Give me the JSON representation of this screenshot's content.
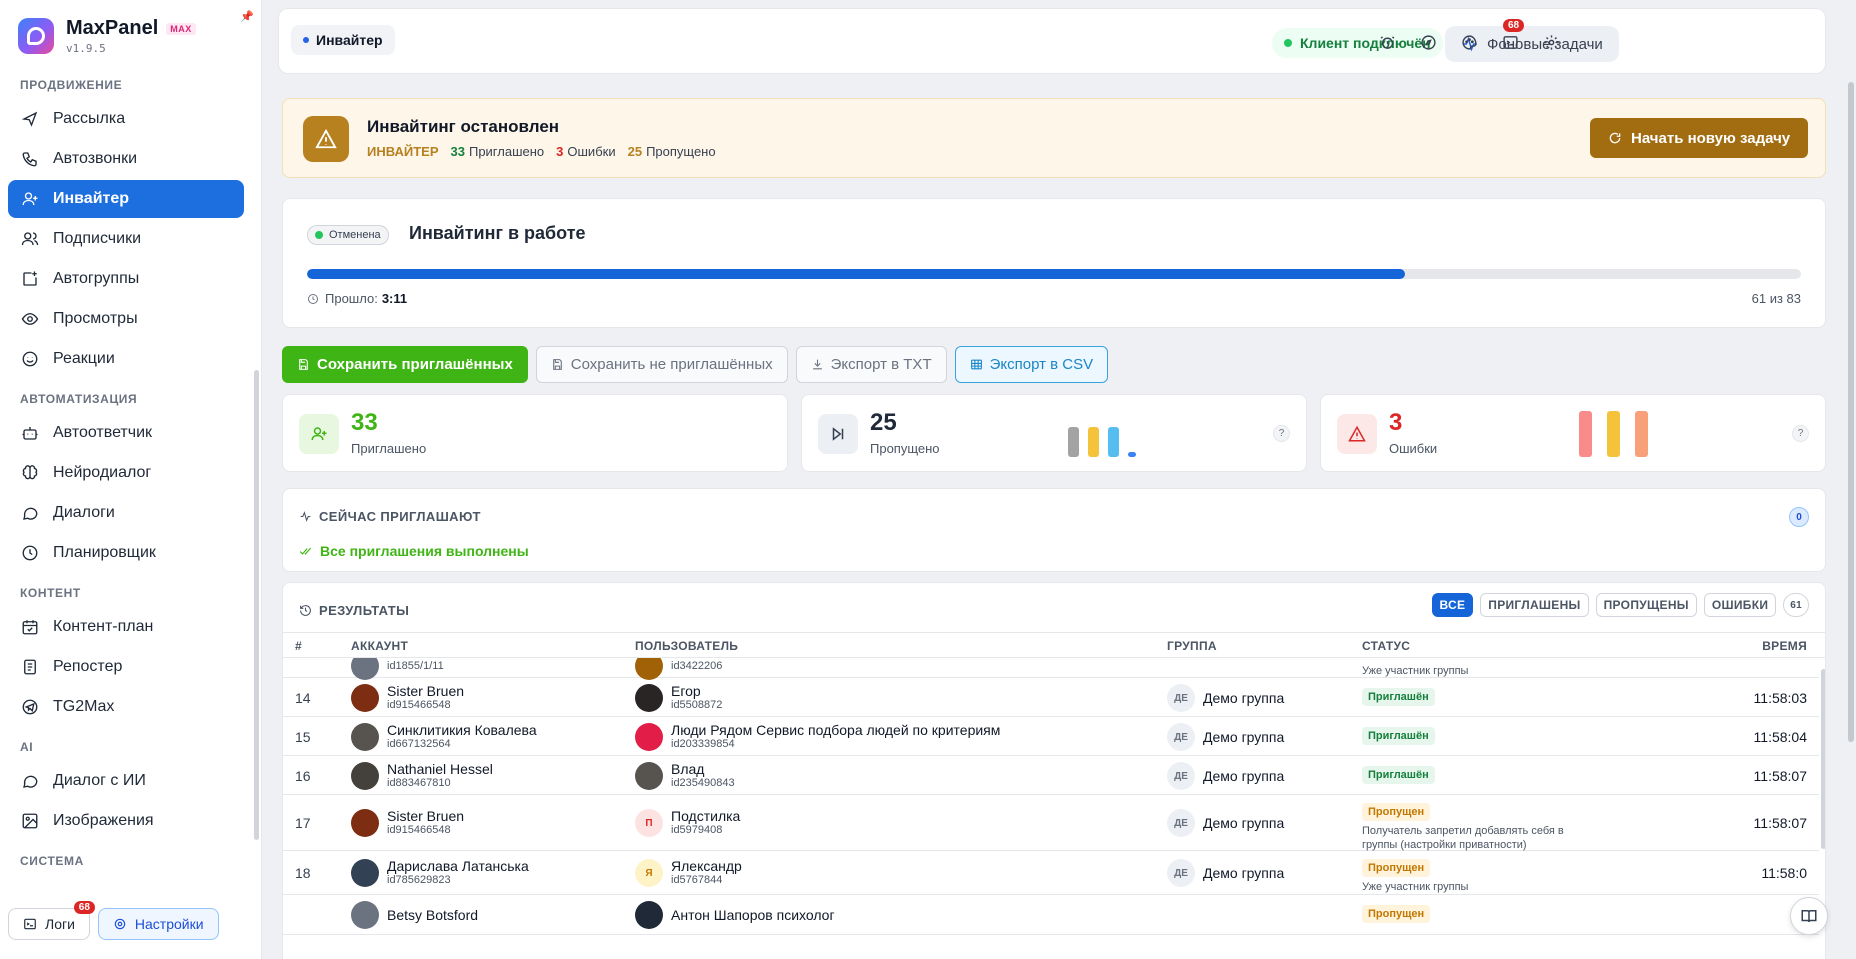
{
  "brand": {
    "name": "MaxPanel",
    "badge": "MAX",
    "version": "v1.9.5"
  },
  "sidebar": {
    "sections": [
      {
        "title": "ПРОДВИЖЕНИЕ",
        "items": [
          {
            "label": "Рассылка",
            "icon": "send-icon"
          },
          {
            "label": "Автозвонки",
            "icon": "phone-icon"
          },
          {
            "label": "Инвайтер",
            "icon": "user-plus-icon",
            "active": true
          },
          {
            "label": "Подписчики",
            "icon": "users-icon"
          },
          {
            "label": "Автогруппы",
            "icon": "square-plus-icon"
          },
          {
            "label": "Просмотры",
            "icon": "eye-icon"
          },
          {
            "label": "Реакции",
            "icon": "smile-icon"
          }
        ]
      },
      {
        "title": "АВТОМАТИЗАЦИЯ",
        "items": [
          {
            "label": "Автоответчик",
            "icon": "bot-icon"
          },
          {
            "label": "Нейродиалог",
            "icon": "brain-icon"
          },
          {
            "label": "Диалоги",
            "icon": "chat-icon"
          },
          {
            "label": "Планировщик",
            "icon": "clock-icon"
          }
        ]
      },
      {
        "title": "КОНТЕНТ",
        "items": [
          {
            "label": "Контент-план",
            "icon": "calendar-icon"
          },
          {
            "label": "Репостер",
            "icon": "repost-icon"
          },
          {
            "label": "TG2Max",
            "icon": "telegram-icon"
          }
        ]
      },
      {
        "title": "AI",
        "items": [
          {
            "label": "Диалог с ИИ",
            "icon": "chat-icon"
          },
          {
            "label": "Изображения",
            "icon": "image-icon"
          }
        ]
      },
      {
        "title": "СИСТЕМА",
        "items": []
      }
    ],
    "footer": {
      "logs_label": "Логи",
      "logs_badge": "68",
      "settings_label": "Настройки"
    }
  },
  "topbar": {
    "breadcrumb": "Инвайтер",
    "client_status": "Клиент подключён",
    "bg_tasks_label": "Фоновые задачи",
    "notifications_badge": "68",
    "icons": [
      "alarm-icon",
      "compass-icon",
      "palette-icon",
      "terminal-icon",
      "settings-icon"
    ]
  },
  "alert": {
    "title": "Инвайтинг остановлен",
    "tag": "ИНВАЙТЕР",
    "invited_num": "33",
    "invited_label": "Приглашено",
    "errors_num": "3",
    "errors_label": "Ошибки",
    "skipped_num": "25",
    "skipped_label": "Пропущено",
    "button_label": "Начать новую задачу"
  },
  "progress": {
    "state": "Отменена",
    "title": "Инвайтинг в работе",
    "elapsed_label": "Прошло:",
    "elapsed_value": "3:11",
    "done": 61,
    "total": 83,
    "count_text": "61 из 83"
  },
  "actions": {
    "save_invited": "Сохранить приглашённых",
    "save_not_invited": "Сохранить не приглашённых",
    "export_txt": "Экспорт в TXT",
    "export_csv": "Экспорт в CSV"
  },
  "stats": {
    "invited": {
      "value": "33",
      "label": "Приглашено",
      "color": "#3fb515"
    },
    "skipped": {
      "value": "25",
      "label": "Пропущено",
      "help": "?",
      "bars": [
        0.8,
        0.8,
        0.8,
        0.12
      ]
    },
    "errors": {
      "value": "3",
      "label": "Ошибки",
      "help": "?",
      "color": "#dc2626",
      "bars": [
        1,
        1,
        1
      ]
    }
  },
  "now_inviting": {
    "title": "СЕЙЧАС ПРИГЛАШАЮТ",
    "count": "0",
    "done_text": "Все приглашения выполнены"
  },
  "results": {
    "title": "РЕЗУЛЬТАТЫ",
    "filters": [
      "ВСЕ",
      "ПРИГЛАШЕНЫ",
      "ПРОПУЩЕНЫ",
      "ОШИБКИ"
    ],
    "total": "61",
    "columns": {
      "num": "#",
      "account": "АККАУНТ",
      "user": "ПОЛЬЗОВАТЕЛЬ",
      "group": "ГРУППА",
      "status": "СТАТУС",
      "time": "ВРЕМЯ"
    },
    "partial_top": {
      "account_id": "id1855/1/11",
      "user_id": "id3422206",
      "note": "Уже участник группы"
    },
    "rows": [
      {
        "num": "14",
        "acc_name": "Sister Bruen",
        "acc_id": "id915466548",
        "user_name": "Егор",
        "user_id": "id5508872",
        "group_initials": "ДЕ",
        "group": "Демо группа",
        "status": "Приглашён",
        "note": "",
        "time": "11:58:03"
      },
      {
        "num": "15",
        "acc_name": "Синклитикия Ковалева",
        "acc_id": "id667132564",
        "user_name": "Люди Рядом Сервис подбора людей по критериям",
        "user_id": "id203339854",
        "group_initials": "ДЕ",
        "group": "Демо группа",
        "status": "Приглашён",
        "note": "",
        "time": "11:58:04"
      },
      {
        "num": "16",
        "acc_name": "Nathaniel Hessel",
        "acc_id": "id883467810",
        "user_name": "Влад",
        "user_id": "id235490843",
        "group_initials": "ДЕ",
        "group": "Демо группа",
        "status": "Приглашён",
        "note": "",
        "time": "11:58:07"
      },
      {
        "num": "17",
        "acc_name": "Sister Bruen",
        "acc_id": "id915466548",
        "user_name": "Подстилка",
        "user_id": "id5979408",
        "user_initial": "П",
        "group_initials": "ДЕ",
        "group": "Демо группа",
        "status": "Пропущен",
        "note": "Получатель запретил добавлять себя в группы (настройки приватности)",
        "time": "11:58:07"
      },
      {
        "num": "18",
        "acc_name": "Дарислава Латанська",
        "acc_id": "id785629823",
        "user_name": "Ялександр",
        "user_id": "id5767844",
        "user_initial": "Я",
        "group_initials": "ДЕ",
        "group": "Демо группа",
        "status": "Пропущен",
        "note": "Уже участник группы",
        "time": "11:58:0"
      },
      {
        "num": "",
        "acc_name": "Betsy Botsford",
        "acc_id": "",
        "user_name": "Антон Шапоров психолог",
        "user_id": "",
        "group_initials": "",
        "group": "",
        "status": "Пропущен",
        "note": "",
        "time": ""
      }
    ]
  }
}
